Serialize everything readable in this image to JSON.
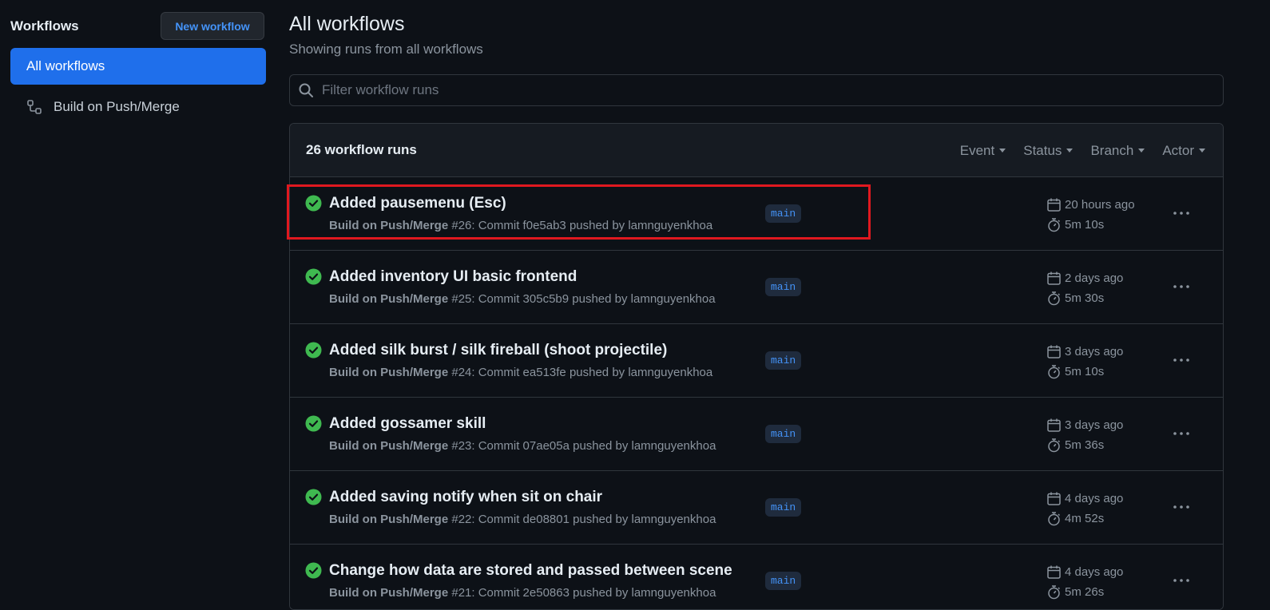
{
  "sidebar": {
    "title": "Workflows",
    "new_workflow_label": "New workflow",
    "items": [
      {
        "label": "All workflows",
        "active": true
      },
      {
        "label": "Build on Push/Merge",
        "icon": "workflow-icon"
      }
    ]
  },
  "main": {
    "title": "All workflows",
    "subtitle": "Showing runs from all workflows",
    "search": {
      "placeholder": "Filter workflow runs",
      "value": ""
    },
    "runs_count": "26 workflow runs",
    "filters": [
      "Event",
      "Status",
      "Branch",
      "Actor"
    ],
    "runs": [
      {
        "title": "Added pausemenu (Esc)",
        "workflow": "Build on Push/Merge",
        "meta": "#26: Commit f0e5ab3 pushed by lamnguyenkhoa",
        "branch": "main",
        "time": "20 hours ago",
        "duration": "5m 10s",
        "status": "success"
      },
      {
        "title": "Added inventory UI basic frontend",
        "workflow": "Build on Push/Merge",
        "meta": "#25: Commit 305c5b9 pushed by lamnguyenkhoa",
        "branch": "main",
        "time": "2 days ago",
        "duration": "5m 30s",
        "status": "success"
      },
      {
        "title": "Added silk burst / silk fireball (shoot projectile)",
        "workflow": "Build on Push/Merge",
        "meta": "#24: Commit ea513fe pushed by lamnguyenkhoa",
        "branch": "main",
        "time": "3 days ago",
        "duration": "5m 10s",
        "status": "success"
      },
      {
        "title": "Added gossamer skill",
        "workflow": "Build on Push/Merge",
        "meta": "#23: Commit 07ae05a pushed by lamnguyenkhoa",
        "branch": "main",
        "time": "3 days ago",
        "duration": "5m 36s",
        "status": "success"
      },
      {
        "title": "Added saving notify when sit on chair",
        "workflow": "Build on Push/Merge",
        "meta": "#22: Commit de08801 pushed by lamnguyenkhoa",
        "branch": "main",
        "time": "4 days ago",
        "duration": "4m 52s",
        "status": "success"
      },
      {
        "title": "Change how data are stored and passed between scene",
        "workflow": "Build on Push/Merge",
        "meta": "#21: Commit 2e50863 pushed by lamnguyenkhoa",
        "branch": "main",
        "time": "4 days ago",
        "duration": "5m 26s",
        "status": "success"
      }
    ]
  },
  "colors": {
    "background": "#0d1117",
    "accent": "#1f6feb",
    "link": "#4493f8",
    "success": "#3fb950",
    "highlight": "#e0181f"
  }
}
